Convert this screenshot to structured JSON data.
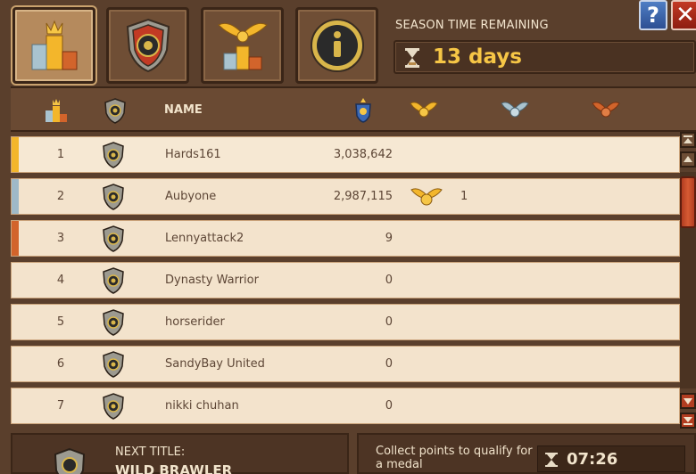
{
  "tabs": [
    {
      "name": "ranking-tab",
      "icon": "podium-crown-icon",
      "active": true
    },
    {
      "name": "guild-tab",
      "icon": "shield-crest-icon",
      "active": false
    },
    {
      "name": "medals-tab",
      "icon": "winged-podium-icon",
      "active": false
    },
    {
      "name": "info-tab",
      "icon": "info-icon",
      "active": false
    }
  ],
  "season": {
    "label": "SEASON TIME REMAINING",
    "value": "13 days"
  },
  "buttons": {
    "help": "?",
    "close": "✕"
  },
  "header": {
    "name": "NAME",
    "icons": [
      "podium-crown-icon",
      "shield-icon",
      "trophy-points-icon",
      "gold-wings-icon",
      "silver-wings-icon",
      "bronze-wings-icon"
    ]
  },
  "rows": [
    {
      "rank": "1",
      "name": "Hards161",
      "points": "3,038,642",
      "medal_count": "",
      "accent": "#f3b62b",
      "has_medal": false
    },
    {
      "rank": "2",
      "name": "Aubyone",
      "points": "2,987,115",
      "medal_count": "1",
      "accent": "#9fb9c7",
      "has_medal": true
    },
    {
      "rank": "3",
      "name": "Lennyattack2",
      "points": "9",
      "medal_count": "",
      "accent": "#d2642b",
      "has_medal": false
    },
    {
      "rank": "4",
      "name": "Dynasty Warrior",
      "points": "0",
      "medal_count": "",
      "accent": "",
      "has_medal": false
    },
    {
      "rank": "5",
      "name": "horserider",
      "points": "0",
      "medal_count": "",
      "accent": "",
      "has_medal": false
    },
    {
      "rank": "6",
      "name": "SandyBay United",
      "points": "0",
      "medal_count": "",
      "accent": "",
      "has_medal": false
    },
    {
      "rank": "7",
      "name": "nikki chuhan",
      "points": "0",
      "medal_count": "",
      "accent": "",
      "has_medal": false
    }
  ],
  "footer": {
    "next_title_label": "NEXT TITLE:",
    "next_title_value": "WILD BRAWLER",
    "collect_text": "Collect points to qualify for a medal",
    "timer": "07:26"
  },
  "colors": {
    "gold": "#f3b62b",
    "silver": "#9fb9c7",
    "bronze": "#d2642b",
    "season_value": "#f6c646"
  }
}
